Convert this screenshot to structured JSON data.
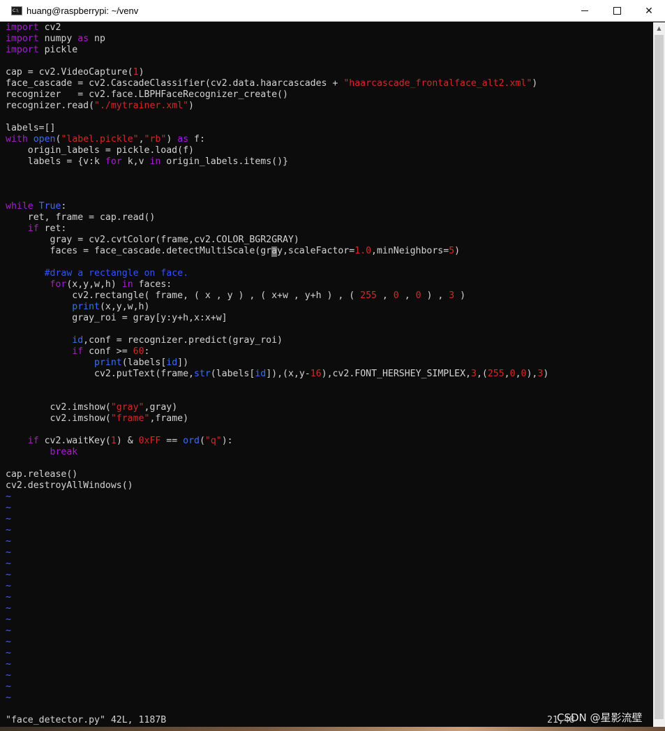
{
  "window": {
    "title": "huang@raspberrypi: ~/venv",
    "app_icon_label": "C:\\",
    "minimize_label": "",
    "maximize_label": "",
    "close_label": "✕"
  },
  "editor": {
    "lines": [
      [
        {
          "t": "import",
          "c": "kw"
        },
        {
          "t": " cv2"
        }
      ],
      [
        {
          "t": "import",
          "c": "kw"
        },
        {
          "t": " numpy "
        },
        {
          "t": "as",
          "c": "kw"
        },
        {
          "t": " np"
        }
      ],
      [
        {
          "t": "import",
          "c": "kw"
        },
        {
          "t": " pickle"
        }
      ],
      [],
      [
        {
          "t": "cap = cv2.VideoCapture("
        },
        {
          "t": "1",
          "c": "num"
        },
        {
          "t": ")"
        }
      ],
      [
        {
          "t": "face_cascade = cv2.CascadeClassifier(cv2.data.haarcascades + "
        },
        {
          "t": "\"haarcascade_frontalface_alt2.xml\"",
          "c": "str"
        },
        {
          "t": ")"
        }
      ],
      [
        {
          "t": "recognizer   = cv2.face.LBPHFaceRecognizer_create()"
        }
      ],
      [
        {
          "t": "recognizer.read("
        },
        {
          "t": "\"./mytrainer.xml\"",
          "c": "str"
        },
        {
          "t": ")"
        }
      ],
      [],
      [
        {
          "t": "labels=[]"
        }
      ],
      [
        {
          "t": "with",
          "c": "kw"
        },
        {
          "t": " "
        },
        {
          "t": "open",
          "c": "fn"
        },
        {
          "t": "("
        },
        {
          "t": "\"label.pickle\"",
          "c": "str"
        },
        {
          "t": ","
        },
        {
          "t": "\"rb\"",
          "c": "str"
        },
        {
          "t": ") "
        },
        {
          "t": "as",
          "c": "kw"
        },
        {
          "t": " f:"
        }
      ],
      [
        {
          "t": "    origin_labels = pickle.load(f)"
        }
      ],
      [
        {
          "t": "    labels = {v:k "
        },
        {
          "t": "for",
          "c": "kw"
        },
        {
          "t": " k,v "
        },
        {
          "t": "in",
          "c": "kw"
        },
        {
          "t": " origin_labels.items()}"
        }
      ],
      [],
      [],
      [],
      [
        {
          "t": "while",
          "c": "kw"
        },
        {
          "t": " "
        },
        {
          "t": "True",
          "c": "fn"
        },
        {
          "t": ":"
        }
      ],
      [
        {
          "t": "    ret, frame = cap.read()"
        }
      ],
      [
        {
          "t": "    "
        },
        {
          "t": "if",
          "c": "kw"
        },
        {
          "t": " ret:"
        }
      ],
      [
        {
          "t": "        gray = cv2.cvtColor(frame,cv2.COLOR_BGR2GRAY)"
        }
      ],
      [
        {
          "t": "        faces = face_cascade.detectMultiScale(gray,scaleFactor="
        },
        {
          "t": "1.0",
          "c": "num"
        },
        {
          "t": ",minNeighbors="
        },
        {
          "t": "5",
          "c": "num"
        },
        {
          "t": ")"
        }
      ],
      [],
      [
        {
          "t": "       "
        },
        {
          "t": "#draw a rectangle on face.",
          "c": "cm"
        }
      ],
      [
        {
          "t": "        "
        },
        {
          "t": "for",
          "c": "kw"
        },
        {
          "t": "(x,y,w,h) "
        },
        {
          "t": "in",
          "c": "kw"
        },
        {
          "t": " faces:"
        }
      ],
      [
        {
          "t": "            cv2.rectangle( frame, ( x , y ) , ( x+w , y+h ) , ( "
        },
        {
          "t": "255",
          "c": "num"
        },
        {
          "t": " , "
        },
        {
          "t": "0",
          "c": "num"
        },
        {
          "t": " , "
        },
        {
          "t": "0",
          "c": "num"
        },
        {
          "t": " ) , "
        },
        {
          "t": "3",
          "c": "num"
        },
        {
          "t": " )"
        }
      ],
      [
        {
          "t": "            "
        },
        {
          "t": "print",
          "c": "fn"
        },
        {
          "t": "(x,y,w,h)"
        }
      ],
      [
        {
          "t": "            gray_roi = gray[y:y+h,x:x+w]"
        }
      ],
      [],
      [
        {
          "t": "            "
        },
        {
          "t": "id",
          "c": "fn"
        },
        {
          "t": ",conf = recognizer.predict(gray_roi)"
        }
      ],
      [
        {
          "t": "            "
        },
        {
          "t": "if",
          "c": "kw"
        },
        {
          "t": " conf >= "
        },
        {
          "t": "60",
          "c": "num"
        },
        {
          "t": ":"
        }
      ],
      [
        {
          "t": "                "
        },
        {
          "t": "print",
          "c": "fn"
        },
        {
          "t": "(labels["
        },
        {
          "t": "id",
          "c": "fn"
        },
        {
          "t": "])"
        }
      ],
      [
        {
          "t": "                cv2.putText(frame,"
        },
        {
          "t": "str",
          "c": "fn"
        },
        {
          "t": "(labels["
        },
        {
          "t": "id",
          "c": "fn"
        },
        {
          "t": "]),(x,y-"
        },
        {
          "t": "16",
          "c": "num"
        },
        {
          "t": "),cv2.FONT_HERSHEY_SIMPLEX,"
        },
        {
          "t": "3",
          "c": "num"
        },
        {
          "t": ",("
        },
        {
          "t": "255",
          "c": "num"
        },
        {
          "t": ","
        },
        {
          "t": "0",
          "c": "num"
        },
        {
          "t": ","
        },
        {
          "t": "0",
          "c": "num"
        },
        {
          "t": "),"
        },
        {
          "t": "3",
          "c": "num"
        },
        {
          "t": ")"
        }
      ],
      [],
      [],
      [
        {
          "t": "        cv2.imshow("
        },
        {
          "t": "\"gray\"",
          "c": "str"
        },
        {
          "t": ",gray)"
        }
      ],
      [
        {
          "t": "        cv2.imshow("
        },
        {
          "t": "\"frame\"",
          "c": "str"
        },
        {
          "t": ",frame)"
        }
      ],
      [],
      [
        {
          "t": "    "
        },
        {
          "t": "if",
          "c": "kw"
        },
        {
          "t": " cv2.waitKey("
        },
        {
          "t": "1",
          "c": "num"
        },
        {
          "t": ") & "
        },
        {
          "t": "0xFF",
          "c": "num"
        },
        {
          "t": " == "
        },
        {
          "t": "ord",
          "c": "fn"
        },
        {
          "t": "("
        },
        {
          "t": "\"q\"",
          "c": "str"
        },
        {
          "t": "):"
        }
      ],
      [
        {
          "t": "        "
        },
        {
          "t": "break",
          "c": "kw"
        }
      ],
      [],
      [
        {
          "t": "cap.release()"
        }
      ],
      [
        {
          "t": "cv2.destroyAllWindows()"
        }
      ]
    ],
    "tilde_char": "~",
    "tilde_count": 19,
    "cursor_line": 20,
    "cursor_col": 48,
    "status_left": "\"face_detector.py\" 42L, 1187B",
    "status_right": "21,48"
  },
  "watermark": "CSDN @星影流壁",
  "colors": {
    "background": "#0c0c0c",
    "text": "#d4d4d4",
    "keyword": "#a61ed2",
    "builtin": "#3b6cf6",
    "string_number": "#d12a2a",
    "comment": "#3355ee"
  }
}
